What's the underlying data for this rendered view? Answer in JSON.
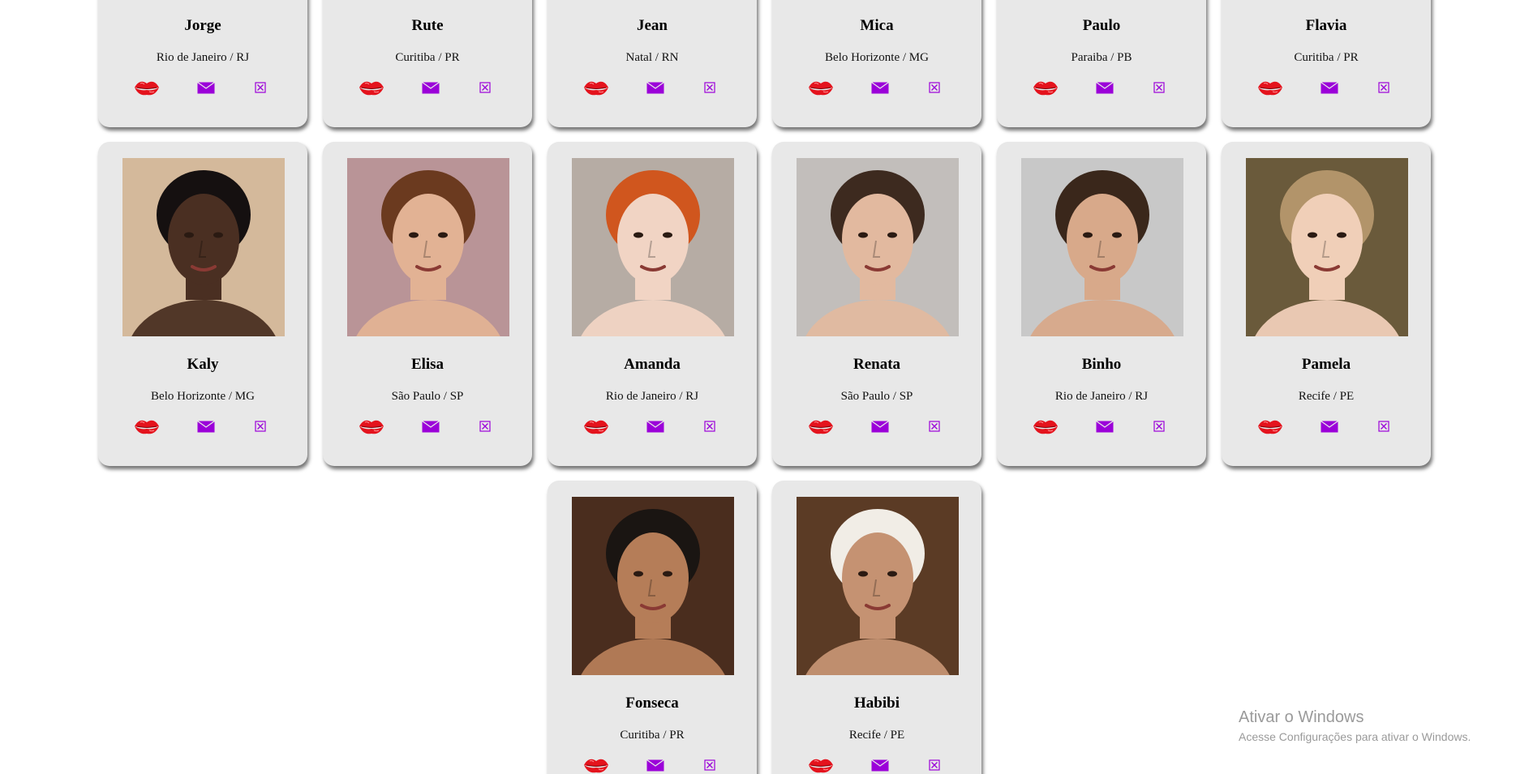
{
  "profiles": [
    {
      "name": "Jorge",
      "city": "Rio de Janeiro / RJ",
      "skin": "#b88a6a",
      "hair": "#2a1e16",
      "bg": "#cfc3b3"
    },
    {
      "name": "Rute",
      "city": "Curitiba / PR",
      "skin": "#e0b396",
      "hair": "#5a3620",
      "bg": "#c9b1a6"
    },
    {
      "name": "Jean",
      "city": "Natal / RN",
      "skin": "#d9a880",
      "hair": "#3b2a1d",
      "bg": "#bdb6ad"
    },
    {
      "name": "Mica",
      "city": "Belo Horizonte / MG",
      "skin": "#e6bfa3",
      "hair": "#4a3020",
      "bg": "#c6c0b8"
    },
    {
      "name": "Paulo",
      "city": "Paraiba / PB",
      "skin": "#d8a886",
      "hair": "#3a2618",
      "bg": "#bfbfbf"
    },
    {
      "name": "Flavia",
      "city": "Curitiba / PR",
      "skin": "#ecc6ab",
      "hair": "#b08c5c",
      "bg": "#7a7a55"
    },
    {
      "name": "Kaly",
      "city": "Belo Horizonte / MG",
      "skin": "#4a2f22",
      "hair": "#151010",
      "bg": "#d4b99b"
    },
    {
      "name": "Elisa",
      "city": "São Paulo / SP",
      "skin": "#e2b294",
      "hair": "#6b3a1f",
      "bg": "#b99497"
    },
    {
      "name": "Amanda",
      "city": "Rio de Janeiro / RJ",
      "skin": "#f1d4c4",
      "hair": "#d0561e",
      "bg": "#b6aca4"
    },
    {
      "name": "Renata",
      "city": "São Paulo / SP",
      "skin": "#e2b99f",
      "hair": "#3d2a1f",
      "bg": "#c2bebb"
    },
    {
      "name": "Binho",
      "city": "Rio de Janeiro / RJ",
      "skin": "#d8a98a",
      "hair": "#3a271b",
      "bg": "#c8c8c8"
    },
    {
      "name": "Pamela",
      "city": "Recife / PE",
      "skin": "#f0cfb8",
      "hair": "#b2946a",
      "bg": "#6a5a3b"
    },
    {
      "name": "Fonseca",
      "city": "Curitiba / PR",
      "skin": "#b57d58",
      "hair": "#1a1512",
      "bg": "#4a2d1e"
    },
    {
      "name": "Habibi",
      "city": "Recife / PE",
      "skin": "#c59272",
      "hair": "#f1ede6",
      "bg": "#5b3b25"
    }
  ],
  "colors": {
    "kiss": "#e4131d",
    "mail": "#9b00d9",
    "close": "#9b00d9",
    "card_bg": "#e8e8e8"
  },
  "icons": {
    "kiss": "kiss-lips-icon",
    "mail": "envelope-icon",
    "close": "close-box-icon"
  },
  "watermark": {
    "title": "Ativar o Windows",
    "subtitle": "Acesse Configurações para ativar o Windows."
  }
}
